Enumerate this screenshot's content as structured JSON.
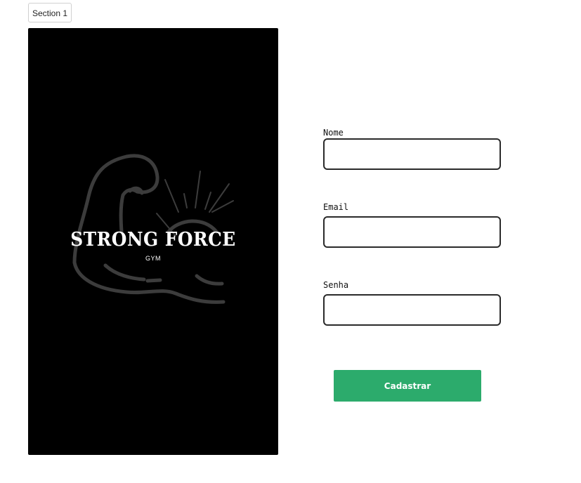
{
  "section_tab": {
    "label": "Section 1"
  },
  "brand": {
    "name": "STRONG FORCE",
    "tagline": "GYM",
    "logo_icon": "flexed-arm-icon",
    "background_color": "#000000",
    "logo_line_color": "#3c3c3c"
  },
  "form": {
    "fields": [
      {
        "label": "Nome",
        "value": "",
        "placeholder": ""
      },
      {
        "label": "Email",
        "value": "",
        "placeholder": ""
      },
      {
        "label": "Senha",
        "value": "",
        "placeholder": ""
      }
    ],
    "submit_label": "Cadastrar",
    "submit_color": "#2cab6c"
  }
}
